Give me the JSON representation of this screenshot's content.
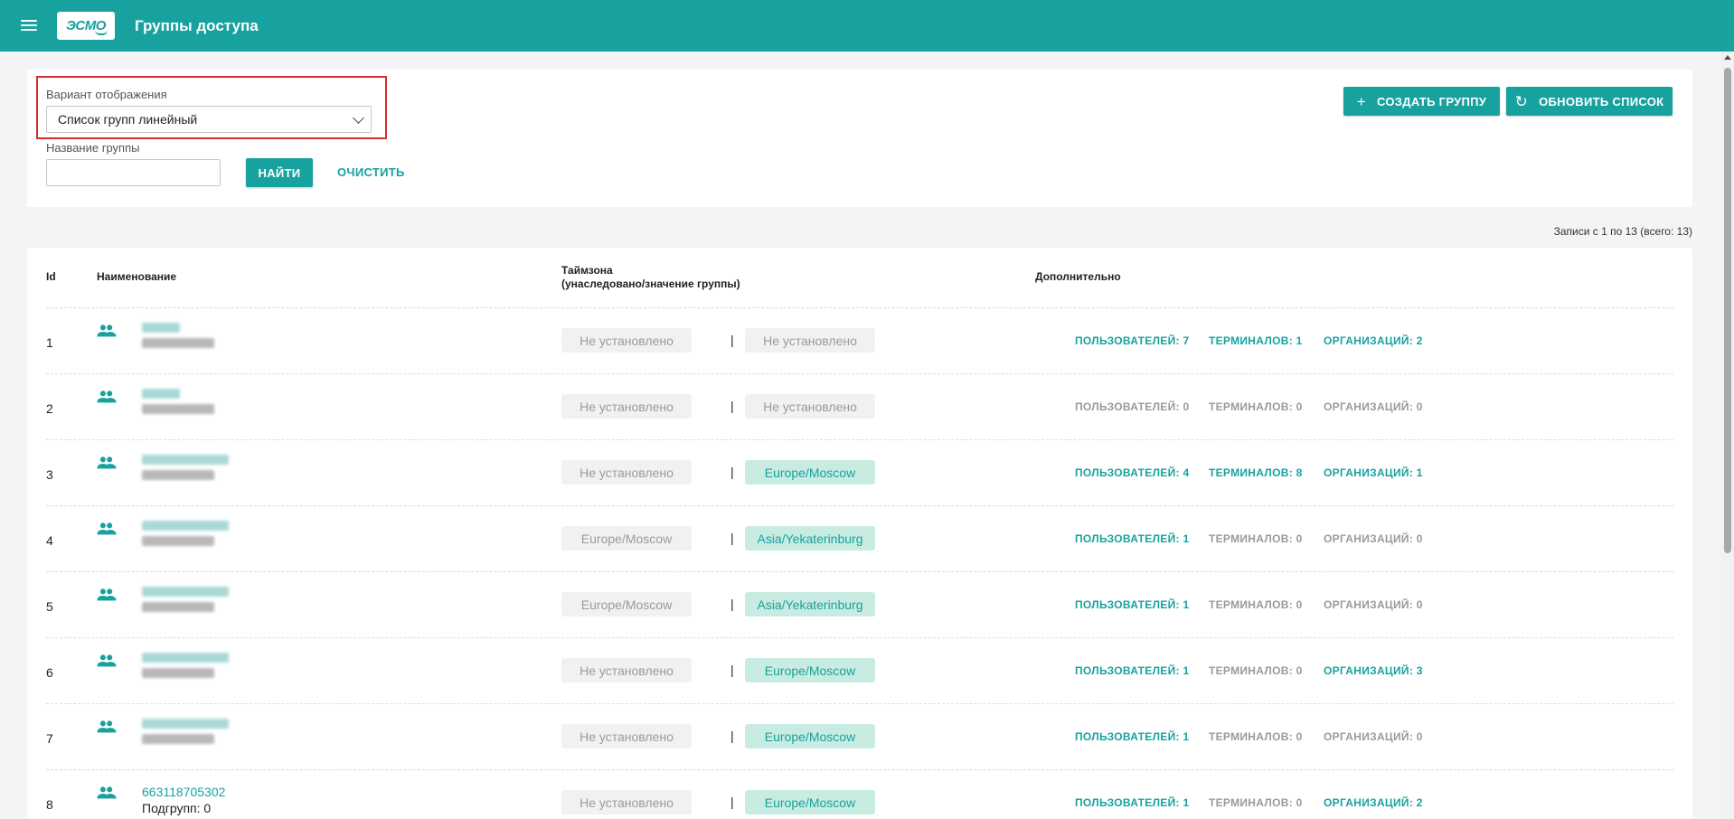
{
  "header": {
    "logo_text": "ЭСМО",
    "title": "Группы доступа"
  },
  "filters": {
    "view_label": "Вариант отображения",
    "view_value": "Список групп линейный",
    "name_label": "Название группы",
    "name_value": "",
    "find_label": "НАЙТИ",
    "clear_label": "ОЧИСТИТЬ"
  },
  "actions": {
    "create_label": "СОЗДАТЬ ГРУППУ",
    "refresh_label": "ОБНОВИТЬ СПИСОК"
  },
  "records_info": "Записи с 1 по 13 (всего: 13)",
  "table": {
    "col_id": "Id",
    "col_name": "Наименование",
    "col_tz_line1": "Таймзона",
    "col_tz_line2": "(унаследовано/значение группы)",
    "col_extra": "Дополнительно",
    "separator": "|",
    "rows": [
      {
        "id": "1",
        "name": "",
        "sub": "",
        "tz_inherited": "Не установлено",
        "tz_own": "Не установлено",
        "tz_own_set": false,
        "users": "ПОЛЬЗОВАТЕЛЕЙ: 7",
        "users_active": true,
        "terminals": "ТЕРМИНАЛОВ: 1",
        "terminals_active": true,
        "orgs": "ОРГАНИЗАЦИЙ: 2",
        "orgs_active": true
      },
      {
        "id": "2",
        "name": "",
        "sub": "",
        "tz_inherited": "Не установлено",
        "tz_own": "Не установлено",
        "tz_own_set": false,
        "users": "ПОЛЬЗОВАТЕЛЕЙ: 0",
        "users_active": false,
        "terminals": "ТЕРМИНАЛОВ: 0",
        "terminals_active": false,
        "orgs": "ОРГАНИЗАЦИЙ: 0",
        "orgs_active": false
      },
      {
        "id": "3",
        "name": "",
        "sub": "",
        "tz_inherited": "Не установлено",
        "tz_own": "Europe/Moscow",
        "tz_own_set": true,
        "users": "ПОЛЬЗОВАТЕЛЕЙ: 4",
        "users_active": true,
        "terminals": "ТЕРМИНАЛОВ: 8",
        "terminals_active": true,
        "orgs": "ОРГАНИЗАЦИЙ: 1",
        "orgs_active": true
      },
      {
        "id": "4",
        "name": "",
        "sub": "",
        "tz_inherited": "Europe/Moscow",
        "tz_own": "Asia/Yekaterinburg",
        "tz_own_set": true,
        "users": "ПОЛЬЗОВАТЕЛЕЙ: 1",
        "users_active": true,
        "terminals": "ТЕРМИНАЛОВ: 0",
        "terminals_active": false,
        "orgs": "ОРГАНИЗАЦИЙ: 0",
        "orgs_active": false
      },
      {
        "id": "5",
        "name": "",
        "sub": "",
        "tz_inherited": "Europe/Moscow",
        "tz_own": "Asia/Yekaterinburg",
        "tz_own_set": true,
        "users": "ПОЛЬЗОВАТЕЛЕЙ: 1",
        "users_active": true,
        "terminals": "ТЕРМИНАЛОВ: 0",
        "terminals_active": false,
        "orgs": "ОРГАНИЗАЦИЙ: 0",
        "orgs_active": false
      },
      {
        "id": "6",
        "name": "",
        "sub": "",
        "tz_inherited": "Не установлено",
        "tz_own": "Europe/Moscow",
        "tz_own_set": true,
        "users": "ПОЛЬЗОВАТЕЛЕЙ: 1",
        "users_active": true,
        "terminals": "ТЕРМИНАЛОВ: 0",
        "terminals_active": false,
        "orgs": "ОРГАНИЗАЦИЙ: 3",
        "orgs_active": true
      },
      {
        "id": "7",
        "name": "",
        "sub": "",
        "tz_inherited": "Не установлено",
        "tz_own": "Europe/Moscow",
        "tz_own_set": true,
        "users": "ПОЛЬЗОВАТЕЛЕЙ: 1",
        "users_active": true,
        "terminals": "ТЕРМИНАЛОВ: 0",
        "terminals_active": false,
        "orgs": "ОРГАНИЗАЦИЙ: 0",
        "orgs_active": false
      },
      {
        "id": "8",
        "name": "663118705302",
        "sub": "Подгрупп: 0",
        "tz_inherited": "Не установлено",
        "tz_own": "Europe/Moscow",
        "tz_own_set": true,
        "users": "ПОЛЬЗОВАТЕЛЕЙ: 1",
        "users_active": true,
        "terminals": "ТЕРМИНАЛОВ: 0",
        "terminals_active": false,
        "orgs": "ОРГАНИЗАЦИЙ: 2",
        "orgs_active": true
      }
    ]
  },
  "colors": {
    "accent": "#17a29f",
    "chip_set_bg": "#c8ece2",
    "chip_unset_bg": "#f1f1f1",
    "highlight": "#d32f2f"
  },
  "icons": {
    "menu": "hamburger-menu-icon",
    "dropdown": "chevron-down-icon",
    "create": "plus-icon",
    "refresh": "refresh-icon",
    "group": "group-people-icon"
  }
}
